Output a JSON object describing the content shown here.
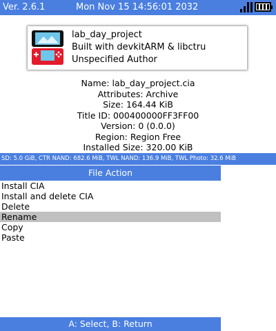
{
  "status_bar": {
    "version": "Ver. 2.6.1",
    "datetime": "Mon Nov 15 14:56:01 2032",
    "wifi_icon": "signal-bars-icon",
    "battery_icon": "battery-icon",
    "accent_color": "#4a7fe0"
  },
  "title_card": {
    "icon": "nintendo-3ds-icon",
    "title": "lab_day_project",
    "subtitle": "Built with devkitARM & libctru",
    "author": "Unspecified Author"
  },
  "file_info": {
    "name": "Name: lab_day_project.cia",
    "attributes": "Attributes: Archive",
    "size": "Size: 164.44 KiB",
    "title_id": "Title ID: 000400000FF3FF00",
    "version": "Version: 0 (0.0.0)",
    "region": "Region: Region Free",
    "installed_size": "Installed Size: 320.00 KiB"
  },
  "storage_bar": {
    "text": "SD: 5.0 GiB, CTR NAND: 682.6 MiB, TWL NAND: 136.9 MiB, TWL Photo: 32.6 MiB"
  },
  "file_action": {
    "header": "File Action",
    "items": [
      {
        "label": "Install CIA",
        "selected": false
      },
      {
        "label": "Install and delete CIA",
        "selected": false
      },
      {
        "label": "Delete",
        "selected": false
      },
      {
        "label": "Rename",
        "selected": true
      },
      {
        "label": "Copy",
        "selected": false
      },
      {
        "label": "Paste",
        "selected": false
      }
    ],
    "footer": "A: Select, B: Return",
    "selected_color": "#c0c0c0"
  }
}
